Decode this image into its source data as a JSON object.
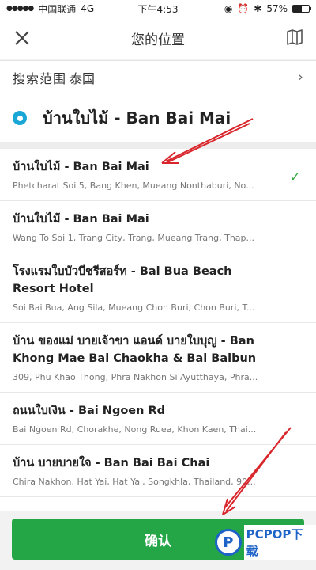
{
  "status_bar": {
    "carrier": "中国联通",
    "network": "4G",
    "time": "下午4:53",
    "battery": "57%",
    "battery_level": 0.57
  },
  "header": {
    "title": "您的位置"
  },
  "scope": {
    "label": "搜索范围",
    "value": "泰国"
  },
  "search": {
    "query": "บ้านใบไม้ - Ban Bai Mai"
  },
  "results": [
    {
      "name": "บ้านใบไม้ - Ban Bai Mai",
      "address": "Phetcharat Soi 5, Bang Khen, Mueang Nonthaburi, No...",
      "selected": true
    },
    {
      "name": "บ้านใบไม้ - Ban Bai Mai",
      "address": "Wang To Soi 1, Trang City, Trang, Mueang Trang, Thap...",
      "selected": false
    },
    {
      "name": "โรงแรมใบบัวบีชรีสอร์ท - Bai Bua Beach Resort Hotel",
      "address": "Soi Bai Bua, Ang Sila, Mueang Chon Buri, Chon Buri, T...",
      "selected": false
    },
    {
      "name": "บ้าน ของแม่ บายเจ้าขา แอนด์ บายใบบุญ - Ban Khong Mae Bai Chaokha & Bai Baibun",
      "address": "309, Phu Khao Thong, Phra Nakhon Si Ayutthaya, Phra...",
      "selected": false
    },
    {
      "name": "ถนนใบเงิน - Bai Ngoen Rd",
      "address": "Bai Ngoen Rd, Chorakhe, Nong Ruea, Khon Kaen, Thai...",
      "selected": false
    },
    {
      "name": "บ้าน บายบายใจ - Ban Bai Bai Chai",
      "address": "Chira Nakhon, Hat Yai, Hat Yai, Songkhla, Thailand, 90...",
      "selected": false
    }
  ],
  "confirm": {
    "label": "确认"
  },
  "watermark": {
    "text": "PCPOP下载"
  },
  "colors": {
    "accent_green": "#24a647",
    "radio_blue": "#1aa7d6",
    "annotation_red": "#d9262c"
  }
}
